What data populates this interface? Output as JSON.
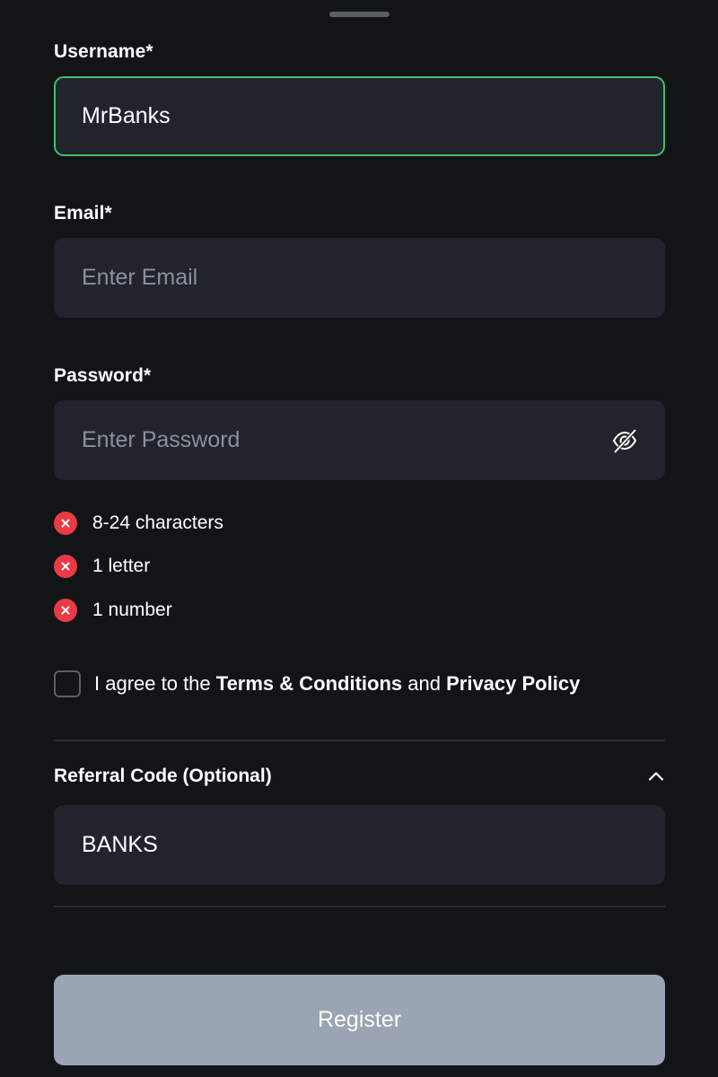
{
  "username": {
    "label": "Username*",
    "value": "MrBanks",
    "placeholder": ""
  },
  "email": {
    "label": "Email*",
    "value": "",
    "placeholder": "Enter Email"
  },
  "password": {
    "label": "Password*",
    "value": "",
    "placeholder": "Enter Password",
    "toggle_icon": "eye-off-icon",
    "rules": [
      {
        "text": "8-24 characters",
        "status": "failed",
        "icon": "error-x-icon"
      },
      {
        "text": "1 letter",
        "status": "failed",
        "icon": "error-x-icon"
      },
      {
        "text": "1 number",
        "status": "failed",
        "icon": "error-x-icon"
      }
    ]
  },
  "agreement": {
    "checked": false,
    "prefix": "I agree to the ",
    "terms_link": "Terms & Conditions",
    "joiner": " and ",
    "privacy_link": "Privacy Policy"
  },
  "referral": {
    "label": "Referral Code (Optional)",
    "expanded": true,
    "toggle_icon": "chevron-up-icon",
    "value": "BANKS",
    "placeholder": ""
  },
  "register_button": {
    "label": "Register",
    "enabled": false
  },
  "colors": {
    "background": "#131418",
    "field_bg": "#21242c",
    "active_border": "#3fc06a",
    "error": "#ea3a45",
    "button_disabled": "#9aa4b2",
    "placeholder": "#8b909b"
  }
}
